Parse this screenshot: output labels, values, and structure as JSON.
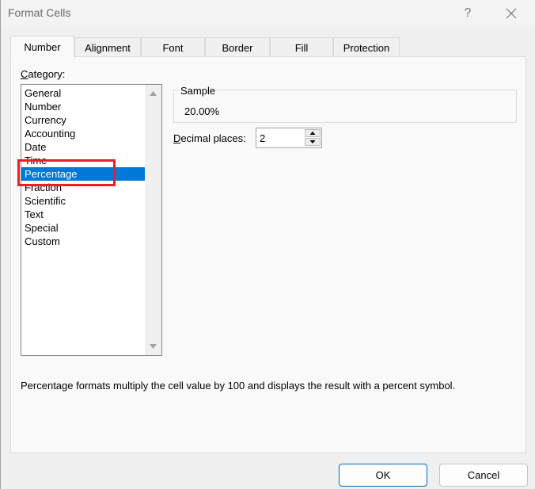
{
  "window": {
    "title": "Format Cells",
    "help_label": "?",
    "help_icon": "question-mark-icon",
    "close_icon": "close-x-icon"
  },
  "tabs": [
    {
      "label": "Number",
      "active": true
    },
    {
      "label": "Alignment",
      "active": false
    },
    {
      "label": "Font",
      "active": false
    },
    {
      "label": "Border",
      "active": false
    },
    {
      "label": "Fill",
      "active": false
    },
    {
      "label": "Protection",
      "active": false
    }
  ],
  "category": {
    "label_accel": "C",
    "label_rest": "ategory:",
    "items": [
      {
        "label": "General",
        "selected": false
      },
      {
        "label": "Number",
        "selected": false
      },
      {
        "label": "Currency",
        "selected": false
      },
      {
        "label": "Accounting",
        "selected": false
      },
      {
        "label": "Date",
        "selected": false
      },
      {
        "label": "Time",
        "selected": false
      },
      {
        "label": "Percentage",
        "selected": true
      },
      {
        "label": "Fraction",
        "selected": false
      },
      {
        "label": "Scientific",
        "selected": false
      },
      {
        "label": "Text",
        "selected": false
      },
      {
        "label": "Special",
        "selected": false
      },
      {
        "label": "Custom",
        "selected": false
      }
    ],
    "scroll_up_icon": "triangle-up-icon",
    "scroll_down_icon": "triangle-down-icon"
  },
  "sample": {
    "label": "Sample",
    "value": "20.00%"
  },
  "decimal_places": {
    "label_accel": "D",
    "label_rest": "ecimal places:",
    "value": "2"
  },
  "description": "Percentage formats multiply the cell value by 100 and displays the result with a percent symbol.",
  "buttons": {
    "ok": "OK",
    "cancel": "Cancel"
  },
  "annotation": {
    "highlight_color": "#e8202a",
    "selection_color": "#0078d7"
  }
}
